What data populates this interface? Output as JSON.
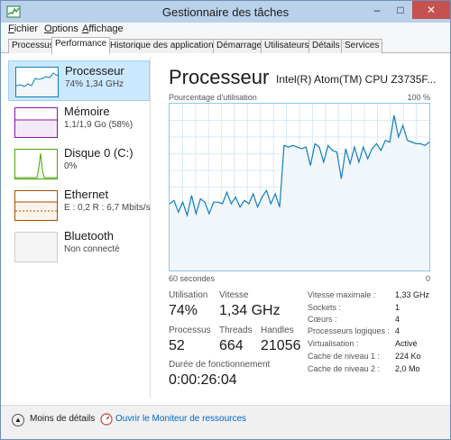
{
  "window": {
    "title": "Gestionnaire des tâches",
    "controls": {
      "minimize": "–",
      "maximize": "□",
      "close": "✕"
    }
  },
  "menu": [
    {
      "label": "Fichier",
      "underline": "F",
      "rest": "ichier"
    },
    {
      "label": "Options",
      "underline": "O",
      "rest": "ptions"
    },
    {
      "label": "Affichage",
      "underline": "A",
      "rest": "ffichage"
    }
  ],
  "tabs": [
    {
      "label": "Processus",
      "active": false
    },
    {
      "label": "Performance",
      "active": true
    },
    {
      "label": "Historique des applications",
      "active": false
    },
    {
      "label": "Démarrage",
      "active": false
    },
    {
      "label": "Utilisateurs",
      "active": false
    },
    {
      "label": "Détails",
      "active": false
    },
    {
      "label": "Services",
      "active": false
    }
  ],
  "resources": [
    {
      "title": "Processeur",
      "sub": "74% 1,34 GHz",
      "color": "#117dbb",
      "selected": true
    },
    {
      "title": "Mémoire",
      "sub": "1,1/1,9 Go (58%)",
      "color": "#8b12ae",
      "selected": false
    },
    {
      "title": "Disque 0 (C:)",
      "sub": "0%",
      "color": "#4da60c",
      "selected": false
    },
    {
      "title": "Ethernet",
      "sub": "E : 0,2  R : 6,7 Mbits/s",
      "color": "#a74f01",
      "selected": false
    },
    {
      "title": "Bluetooth",
      "sub": "Non connecté",
      "color": "#999999",
      "selected": false
    }
  ],
  "detail": {
    "title": "Processeur",
    "cpu_name": "Intel(R) Atom(TM) CPU Z3735F...",
    "chart_label": "Pourcentage d'utilisation",
    "chart_max": "100 %",
    "axis_left": "60 secondes",
    "axis_right": "0"
  },
  "chart_data": {
    "type": "area",
    "color": "#117dbb",
    "fill": "#f1f6fa",
    "ylim": [
      0,
      100
    ],
    "xlim": [
      60,
      0
    ],
    "xlabel": "60 secondes",
    "ylabel": "Pourcentage d'utilisation",
    "values": [
      40,
      42,
      35,
      41,
      33,
      45,
      34,
      43,
      41,
      34,
      41,
      41,
      40,
      47,
      40,
      44,
      38,
      42,
      40,
      46,
      38,
      44,
      48,
      40,
      46,
      38,
      75,
      74,
      75,
      74,
      73,
      74,
      63,
      76,
      74,
      65,
      75,
      72,
      71,
      55,
      73,
      64,
      74,
      65,
      74,
      67,
      73,
      76,
      72,
      78,
      77,
      93,
      80,
      87,
      78,
      77,
      76,
      76,
      75,
      77
    ]
  },
  "stats": [
    {
      "label": "Utilisation",
      "value": "74%"
    },
    {
      "label": "Vitesse",
      "value": "1,34 GHz"
    },
    {
      "label": "Processus",
      "value": "52"
    },
    {
      "label": "Threads",
      "value": "664"
    },
    {
      "label": "Handles",
      "value": "21056"
    },
    {
      "label": "Durée de fonctionnement",
      "value": "0:00:26:04"
    }
  ],
  "specs": [
    {
      "label": "Vitesse maximale :",
      "value": "1,33 GHz"
    },
    {
      "label": "Sockets :",
      "value": "1"
    },
    {
      "label": "Cœurs :",
      "value": "4"
    },
    {
      "label": "Processeurs logiques :",
      "value": "4"
    },
    {
      "label": "Virtualisation :",
      "value": "Activé"
    },
    {
      "label": "Cache de niveau 1 :",
      "value": "224 Ko"
    },
    {
      "label": "Cache de niveau 2 :",
      "value": "2,0 Mo"
    }
  ],
  "footer": {
    "fewer_details": "Moins de détails",
    "resource_monitor": "Ouvrir le Moniteur de ressources"
  },
  "icons": {
    "app": "task-manager-icon",
    "fewer": "chevron-up-icon",
    "monitor": "resource-monitor-icon"
  }
}
